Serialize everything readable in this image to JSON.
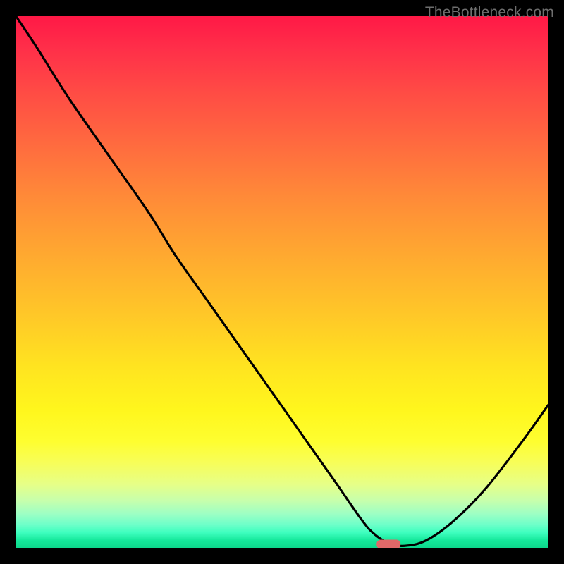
{
  "watermark": "TheBottleneck.com",
  "chart_data": {
    "type": "line",
    "title": "",
    "xlabel": "",
    "ylabel": "",
    "xlim": [
      0,
      100
    ],
    "ylim": [
      0,
      100
    ],
    "grid": false,
    "legend": false,
    "background": "rainbow-gradient-red-to-green",
    "x": [
      0,
      4,
      10,
      18,
      25,
      30,
      36,
      42,
      48,
      54,
      60,
      64.5,
      67,
      70,
      73,
      77,
      82,
      88,
      95,
      100
    ],
    "values": [
      100,
      94,
      84.5,
      73,
      63,
      55,
      46.5,
      38,
      29.5,
      21,
      12.5,
      6,
      3,
      1,
      0.5,
      1.5,
      5,
      11,
      20,
      27
    ],
    "marker": {
      "x": 70,
      "y": 0.8,
      "shape": "rounded-rect",
      "color": "#e06868"
    },
    "notes": "No axes, ticks or labels present. Values estimated from curve shape on 0-100 normalized scale where y=0 is bottom (green) and y=100 is top (red)."
  }
}
